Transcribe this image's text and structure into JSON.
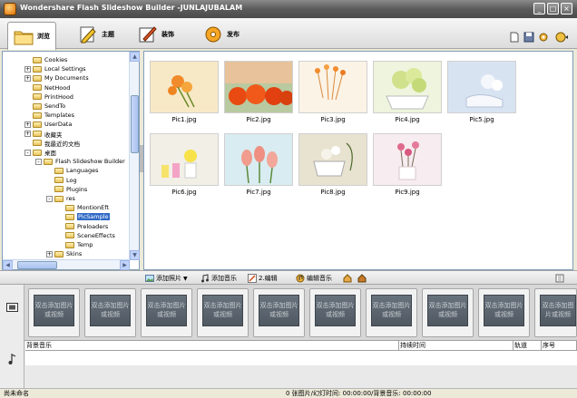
{
  "window": {
    "title": "Wondershare Flash Slideshow Builder -JUNLAJUBALAM",
    "minimize": "_",
    "maximize": "□",
    "close": "×"
  },
  "tabs": [
    {
      "label": "浏览"
    },
    {
      "label": "主题"
    },
    {
      "label": "装饰"
    },
    {
      "label": "发布"
    }
  ],
  "tree": {
    "items": [
      {
        "label": "Cookies",
        "level": 3,
        "expander": ""
      },
      {
        "label": "Local Settings",
        "level": 3,
        "expander": "+"
      },
      {
        "label": "My Documents",
        "level": 3,
        "expander": "+"
      },
      {
        "label": "NetHood",
        "level": 3,
        "expander": ""
      },
      {
        "label": "PrintHood",
        "level": 3,
        "expander": ""
      },
      {
        "label": "SendTo",
        "level": 3,
        "expander": ""
      },
      {
        "label": "Templates",
        "level": 3,
        "expander": ""
      },
      {
        "label": "UserData",
        "level": 3,
        "expander": "+"
      },
      {
        "label": "收藏夹",
        "level": 3,
        "expander": "+"
      },
      {
        "label": "我最近的文档",
        "level": 3,
        "expander": ""
      },
      {
        "label": "桌面",
        "level": 3,
        "expander": "-"
      },
      {
        "label": "Flash Slideshow Builder",
        "level": 4,
        "expander": "-"
      },
      {
        "label": "Languages",
        "level": 5,
        "expander": ""
      },
      {
        "label": "Log",
        "level": 5,
        "expander": ""
      },
      {
        "label": "Plugins",
        "level": 5,
        "expander": ""
      },
      {
        "label": "res",
        "level": 5,
        "expander": "-"
      },
      {
        "label": "MontionEft",
        "level": 6,
        "expander": ""
      },
      {
        "label": "PicSample",
        "level": 6,
        "expander": "",
        "selected": true
      },
      {
        "label": "Preloaders",
        "level": 6,
        "expander": ""
      },
      {
        "label": "SceneEffects",
        "level": 6,
        "expander": ""
      },
      {
        "label": "Temp",
        "level": 6,
        "expander": ""
      },
      {
        "label": "Skins",
        "level": 5,
        "expander": "+"
      },
      {
        "label": "Sounds",
        "level": 5,
        "expander": "+"
      }
    ]
  },
  "pictures": [
    {
      "name": "Pic1.jpg"
    },
    {
      "name": "Pic2.jpg"
    },
    {
      "name": "Pic3.jpg"
    },
    {
      "name": "Pic4.jpg"
    },
    {
      "name": "Pic5.jpg"
    },
    {
      "name": "Pic6.jpg"
    },
    {
      "name": "Pic7.jpg"
    },
    {
      "name": "Pic8.jpg"
    },
    {
      "name": "Pic9.jpg"
    }
  ],
  "bottom_toolbar": {
    "add_photo": "添加照片",
    "add_music": "添加音乐",
    "edit": "2.编辑",
    "edit_music": "编辑音乐"
  },
  "storyboard": {
    "placeholder": "双击添加图片或视频"
  },
  "music_track": {
    "col_background_music": "背景音乐",
    "col_duration": "持续时间",
    "col_track": "轨道",
    "col_order": "序号"
  },
  "status": {
    "left": "尚未命名",
    "center": "0 张图片/幻灯时间: 00:00:00/背景音乐: 00:00:00"
  },
  "colors": {
    "selection": "#316ac5",
    "titlebar": "#5b5b5b"
  }
}
